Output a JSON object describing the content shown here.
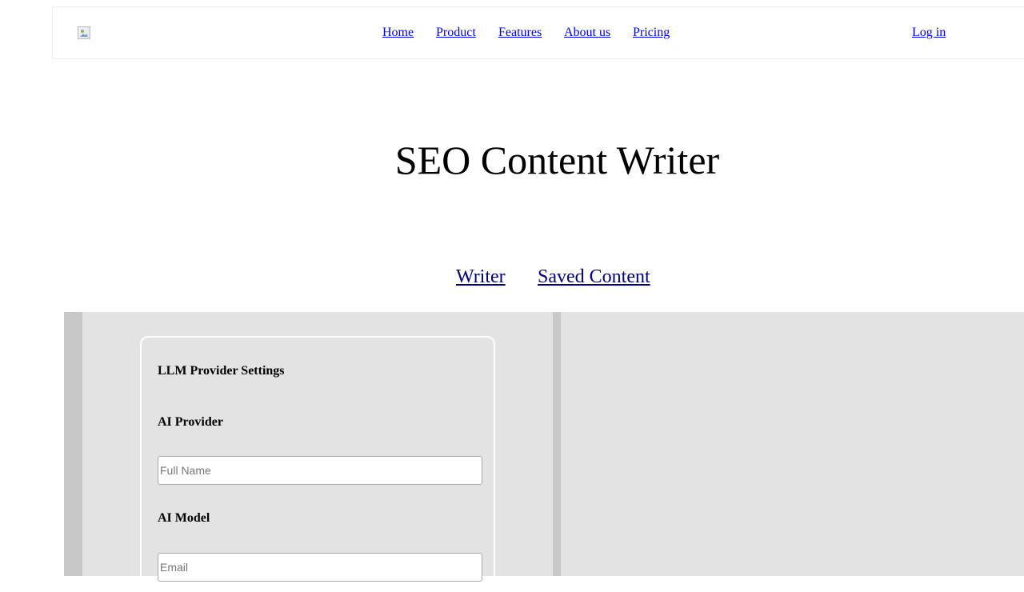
{
  "header": {
    "logo_icon": "broken-image-icon",
    "nav": [
      {
        "label": "Home"
      },
      {
        "label": "Product"
      },
      {
        "label": "Features"
      },
      {
        "label": "About us"
      },
      {
        "label": "Pricing"
      }
    ],
    "login_label": "Log in",
    "link_color": "#0000ee"
  },
  "page": {
    "title": "SEO Content Writer"
  },
  "tabs": [
    {
      "label": "Writer"
    },
    {
      "label": "Saved Content"
    }
  ],
  "settings": {
    "title": "LLM Provider Settings",
    "provider_label": "AI Provider",
    "provider_placeholder": "Full Name",
    "model_label": "AI Model",
    "model_placeholder": "Email"
  },
  "colors": {
    "workspace_bg": "#e3e3e3",
    "rail": "#c8c8c8",
    "tab_link": "#000080"
  }
}
